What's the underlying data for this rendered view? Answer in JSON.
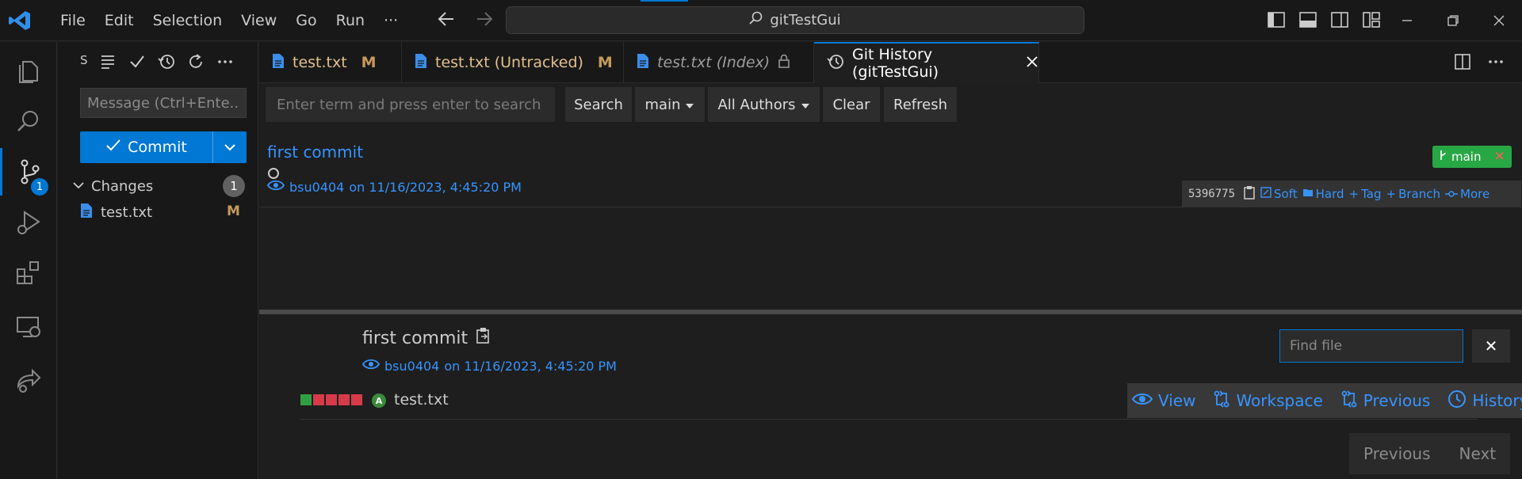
{
  "titlebar": {
    "menu": [
      "File",
      "Edit",
      "Selection",
      "View",
      "Go",
      "Run",
      "···"
    ],
    "command_center": "gitTestGui"
  },
  "activity": {
    "source_control_badge": "1"
  },
  "sidebar": {
    "title": "S",
    "message_placeholder": "Message (Ctrl+Ente...",
    "commit_label": "Commit",
    "changes_label": "Changes",
    "changes_count": "1",
    "change_file": "test.txt",
    "change_status": "M"
  },
  "tabs": [
    {
      "label": "test.txt",
      "status": "M"
    },
    {
      "label": "test.txt (Untracked)",
      "status": "M"
    },
    {
      "label": "test.txt (Index)",
      "status": ""
    },
    {
      "label": "Git History (gitTestGui)",
      "status": ""
    }
  ],
  "history": {
    "search_placeholder": "Enter term and press enter to search",
    "search_button": "Search",
    "branch_select": "main",
    "authors_select": "All Authors",
    "clear_button": "Clear",
    "refresh_button": "Refresh",
    "commit": {
      "title": "first commit",
      "author": "bsu0404",
      "date_text": "on 11/16/2023, 4:45:20 PM",
      "branch": "main",
      "hash": "5396775",
      "actions": [
        "Soft",
        "Hard",
        "Tag",
        "Branch",
        "More"
      ]
    }
  },
  "details": {
    "title": "first commit",
    "author": "bsu0404",
    "date_text": "on 11/16/2023, 4:45:20 PM",
    "find_placeholder": "Find file",
    "file": {
      "added_badge": "A",
      "name": "test.txt",
      "actions": [
        "View",
        "Workspace",
        "Previous",
        "History"
      ]
    },
    "pager": {
      "previous": "Previous",
      "next": "Next"
    }
  },
  "colors": {
    "accent": "#0078d4",
    "link": "#3794ff",
    "modified": "#c59a5a",
    "branch_badge": "#28a745"
  }
}
